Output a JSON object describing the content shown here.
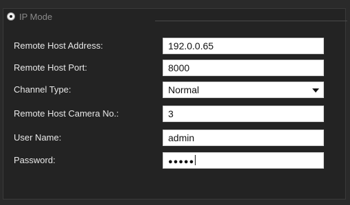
{
  "mode": {
    "label": "IP Mode",
    "selected": true
  },
  "fields": [
    {
      "label": "Remote Host Address:",
      "value": "192.0.0.65"
    },
    {
      "label": "Remote Host Port:",
      "value": "8000"
    },
    {
      "label": "Channel Type:",
      "value": "Normal"
    },
    {
      "label": "Remote Host Camera No.:",
      "value": "3"
    },
    {
      "label": "User Name:",
      "value": "admin"
    },
    {
      "label": "Password:",
      "value": "●●●●●"
    }
  ],
  "icons": {
    "radio": "radio-selected-icon",
    "dropdown": "chevron-down-icon"
  }
}
